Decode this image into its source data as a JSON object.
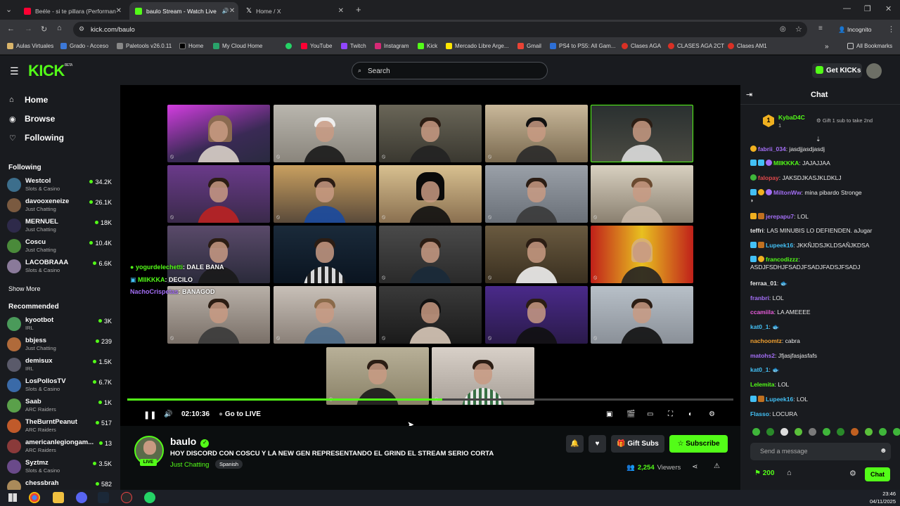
{
  "browser": {
    "tabs": [
      {
        "title": "Beéle - si te pillara (Performanc",
        "icon": "youtube-icon"
      },
      {
        "title": "baulo Stream - Watch Live",
        "icon": "kick-icon"
      },
      {
        "title": "Home / X",
        "icon": "x-icon"
      }
    ],
    "url": "kick.com/baulo",
    "incognito_label": "Incognito",
    "bookmarks": [
      "Aulas Virtuales",
      "Grado - Acceso",
      "Paletools v26.0.11",
      "Home",
      "My Cloud Home",
      "YouTube",
      "Twitch",
      "Instagram",
      "Kick",
      "Mercado Libre Arge...",
      "Gmail",
      "PS4 to PS5: All Gam...",
      "Clases AGA",
      "CLASES AGA 2CT",
      "Clases AM1"
    ],
    "all_bookmarks": "All Bookmarks"
  },
  "header": {
    "logo": "KICK",
    "beta": "BETA",
    "search_placeholder": "Search",
    "get_kicks": "Get KICKs"
  },
  "sidebar": {
    "nav": [
      {
        "label": "Home",
        "icon": "home-icon"
      },
      {
        "label": "Browse",
        "icon": "compass-icon"
      },
      {
        "label": "Following",
        "icon": "heart-icon"
      }
    ],
    "following_title": "Following",
    "following": [
      {
        "name": "Westcol",
        "category": "Slots & Casino",
        "viewers": "34.2K"
      },
      {
        "name": "davooxeneize",
        "category": "Just Chatting",
        "viewers": "26.1K"
      },
      {
        "name": "MERNUEL",
        "category": "Just Chatting",
        "viewers": "18K"
      },
      {
        "name": "Coscu",
        "category": "Just Chatting",
        "viewers": "10.4K"
      },
      {
        "name": "LACOBRAAA",
        "category": "Slots & Casino",
        "viewers": "6.6K"
      }
    ],
    "show_more": "Show More",
    "recommended_title": "Recommended",
    "recommended": [
      {
        "name": "kyootbot",
        "category": "IRL",
        "viewers": "3K"
      },
      {
        "name": "bbjess",
        "category": "Just Chatting",
        "viewers": "239"
      },
      {
        "name": "demisux",
        "category": "IRL",
        "viewers": "1.5K"
      },
      {
        "name": "LosPollosTV",
        "category": "Slots & Casino",
        "viewers": "6.7K"
      },
      {
        "name": "Saab",
        "category": "ARC Raiders",
        "viewers": "1K"
      },
      {
        "name": "TheBurntPeanut",
        "category": "ARC Raiders",
        "viewers": "517"
      },
      {
        "name": "americanlegiongam...",
        "category": "ARC Raiders",
        "viewers": "13"
      },
      {
        "name": "Syztmz",
        "category": "Slots & Casino",
        "viewers": "3.5K"
      },
      {
        "name": "chessbrah",
        "category": "",
        "viewers": "582"
      }
    ]
  },
  "player": {
    "time": "02:10:36",
    "go_live": "Go to LIVE",
    "progress": 0.52,
    "overlay_chat": [
      {
        "user": "yogurdelechetti",
        "text": ": DALE BANA"
      },
      {
        "user": "MIIKKKA",
        "text": ": DECILO"
      },
      {
        "user": "NachoCrispetas",
        "text": ": BANAGOD"
      }
    ]
  },
  "stream": {
    "name": "baulo",
    "live_label": "LIVE",
    "title": "HOY DISCORD CON COSCU Y LA NEW GEN REPRESENTANDO EL GRIND EL STREAM SERIO CORTA",
    "category": "Just Chatting",
    "language": "Spanish",
    "gift_subs": "Gift Subs",
    "subscribe": "Subscribe",
    "viewers": "2,254",
    "viewers_label": "Viewers"
  },
  "chat": {
    "title": "Chat",
    "pinned_user": "KybaD4C",
    "pinned_count": "1",
    "pinned_text": "Gift 1 sub to take 2nd",
    "messages": [
      {
        "user": "fabrii_034",
        "text": ": jasdjjasdjasdj",
        "color": "#a36ef5"
      },
      {
        "user": "MIIKKKA",
        "text": ": JAJAJJAA",
        "color": "#53fc18"
      },
      {
        "user": "falopay",
        "text": ": JAKSDJKASJKLDKLJ",
        "color": "#e0484b"
      },
      {
        "user": "MiltonWw",
        "text": ": mina pibardo Stronge",
        "color": "#a36ef5"
      },
      {
        "user": "jerepapu7",
        "text": ": LOL",
        "color": "#a36ef5"
      },
      {
        "user": "teffri",
        "text": ": LAS MINUBIS LO DEFIENDEN. aJugar",
        "color": "#e8e8e8"
      },
      {
        "user": "Lupeek16",
        "text": ": JKKÑJDSJKLDSAÑJKDSA",
        "color": "#43c0f5"
      },
      {
        "user": "francodizzz",
        "text": ":",
        "color": "#53fc18"
      },
      {
        "user": "",
        "text": "ASDJFSDHJFSADJFSADJFADSJFSADJ",
        "color": "#e8e8e8"
      },
      {
        "user": "ferraa_01",
        "text": ":",
        "color": "#e8e8e8"
      },
      {
        "user": "franbri",
        "text": ": LOL",
        "color": "#a36ef5"
      },
      {
        "user": "ccamiila",
        "text": ": LA AMEEEE",
        "color": "#e85cdb"
      },
      {
        "user": "kat0_1",
        "text": ":",
        "color": "#43c0f5"
      },
      {
        "user": "nachoomtz",
        "text": ": cabra",
        "color": "#f0a030"
      },
      {
        "user": "matohs2",
        "text": ": Jfjasjfasjasfafs",
        "color": "#a36ef5"
      },
      {
        "user": "kat0_1",
        "text": ":",
        "color": "#43c0f5"
      },
      {
        "user": "Lelemita",
        "text": ": LOL",
        "color": "#53fc18"
      },
      {
        "user": "Lupeek16",
        "text": ": LOL",
        "color": "#43c0f5"
      },
      {
        "user": "Flasso",
        "text": ": LOCURA",
        "color": "#43c0f5"
      }
    ],
    "input_placeholder": "Send a message",
    "kicks_balance": "200",
    "chat_button": "Chat"
  },
  "taskbar": {
    "time": "23:46",
    "date": "04/11/2025"
  }
}
